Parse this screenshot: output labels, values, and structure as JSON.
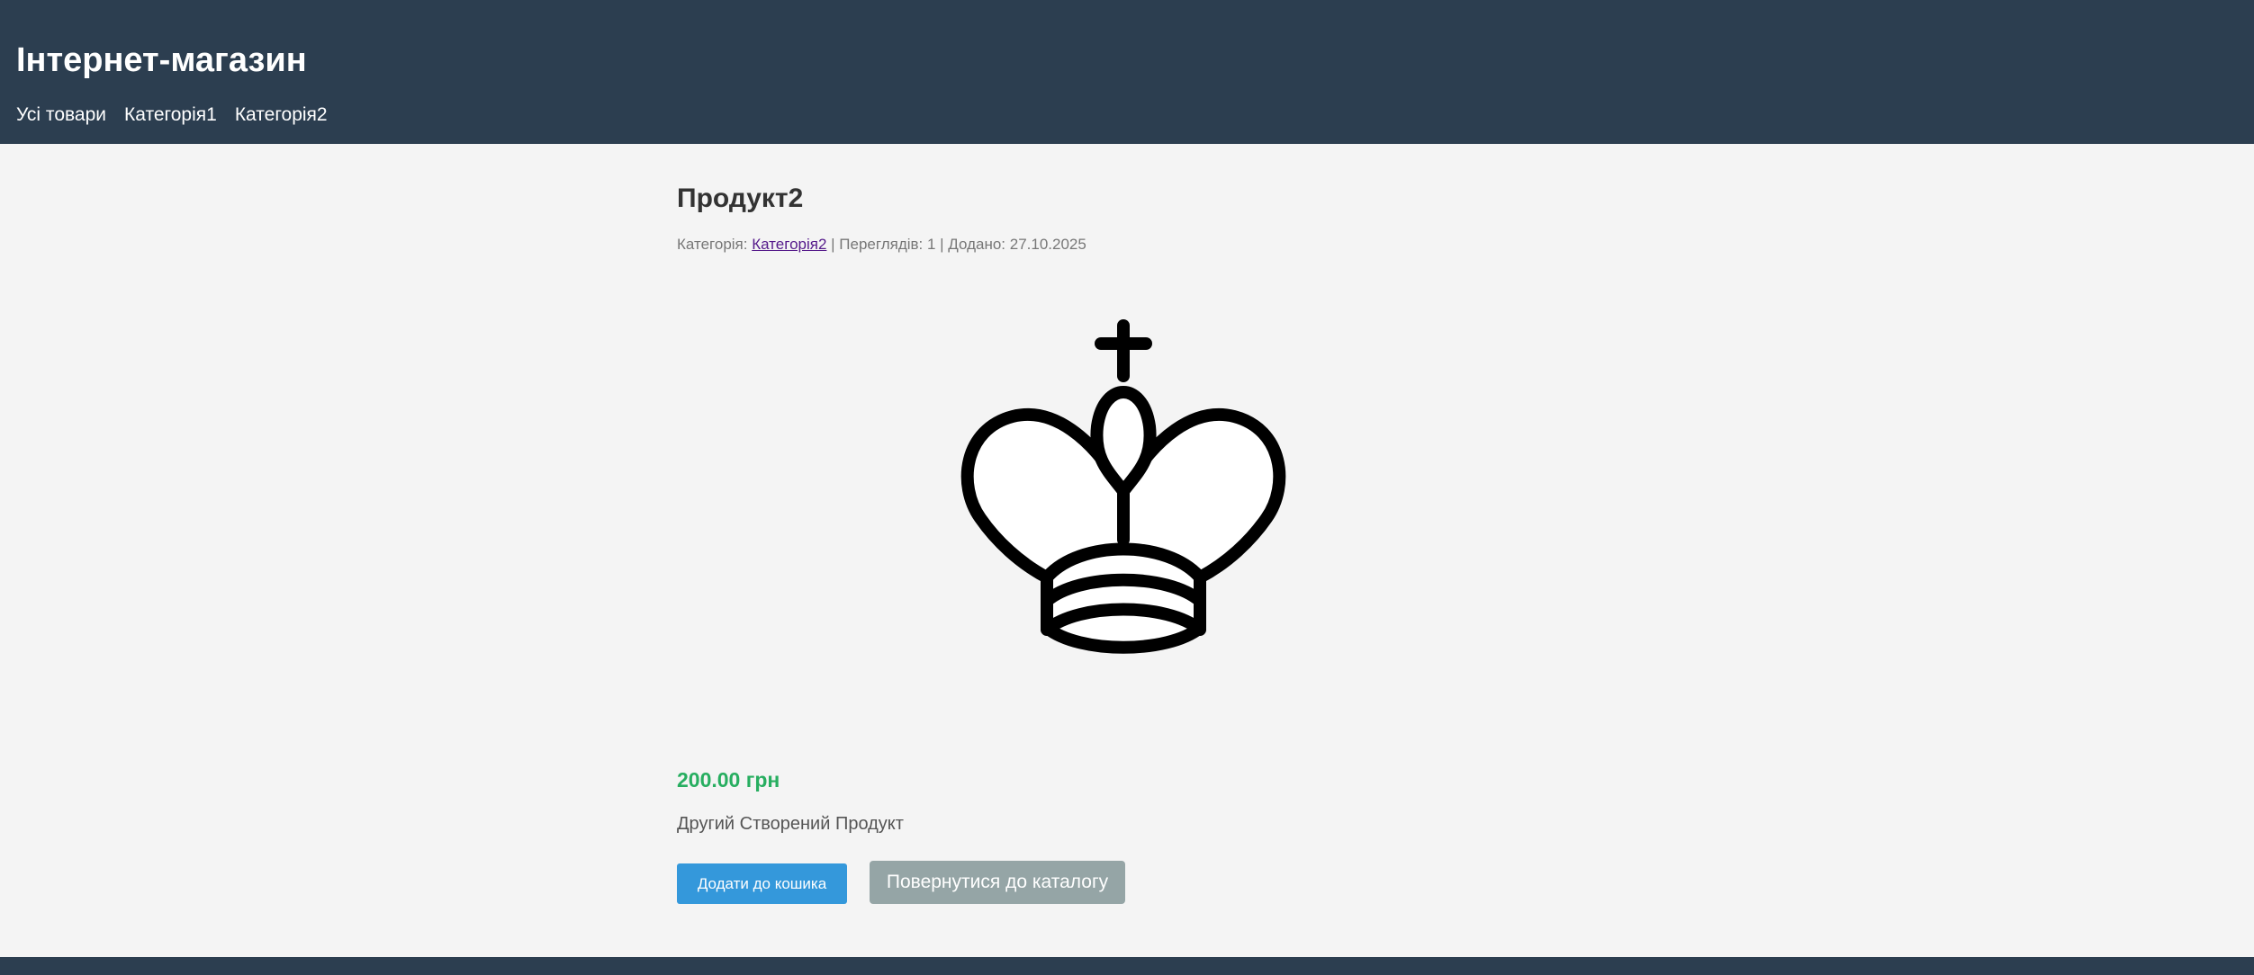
{
  "header": {
    "site_title": "Інтернет-магазин",
    "nav": [
      {
        "label": "Усі товари"
      },
      {
        "label": "Категорія1"
      },
      {
        "label": "Категорія2"
      }
    ]
  },
  "product": {
    "title": "Продукт2",
    "meta": {
      "category_prefix": "Категорія: ",
      "category_link": "Категорія2",
      "rest": " | Переглядів: 1 | Додано: 27.10.2025"
    },
    "image_icon": "chess-king-icon",
    "price": "200.00 грн",
    "description": "Другий Створений Продукт",
    "add_to_cart_label": "Додати до кошика",
    "back_label": "Повернутися до каталогу"
  },
  "colors": {
    "header_bg": "#2c3e50",
    "page_bg": "#f4f4f4",
    "price": "#27ae60",
    "primary_button": "#3498db",
    "secondary_button": "#95a5a6",
    "visited_link": "#551a8b"
  }
}
